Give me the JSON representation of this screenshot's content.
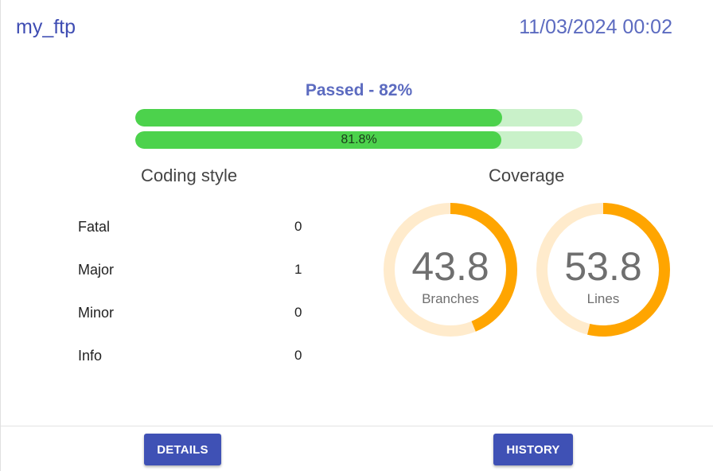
{
  "header": {
    "project_name": "my_ftp",
    "timestamp": "11/03/2024 00:02"
  },
  "status": {
    "text": "Passed - 82%",
    "tests_passed_fraction": 0.82,
    "tests_bar_label": "",
    "coverage_fraction": 0.818,
    "coverage_bar_label": "81.8%",
    "bar_fill_color": "#4cd24c",
    "bar_track_color": "#c9f1c9"
  },
  "coding_style": {
    "title": "Coding style",
    "rows": [
      {
        "name": "Fatal",
        "count": "0"
      },
      {
        "name": "Major",
        "count": "1"
      },
      {
        "name": "Minor",
        "count": "0"
      },
      {
        "name": "Info",
        "count": "0"
      }
    ]
  },
  "coverage": {
    "title": "Coverage",
    "gauges": [
      {
        "value": "43.8",
        "percent": 43.8,
        "label": "Branches"
      },
      {
        "value": "53.8",
        "percent": 53.8,
        "label": "Lines"
      }
    ],
    "arc_color": "#ffa500",
    "track_color": "#ffebcc"
  },
  "actions": {
    "details_label": "DETAILS",
    "history_label": "HISTORY",
    "button_color": "#3f51b5"
  }
}
